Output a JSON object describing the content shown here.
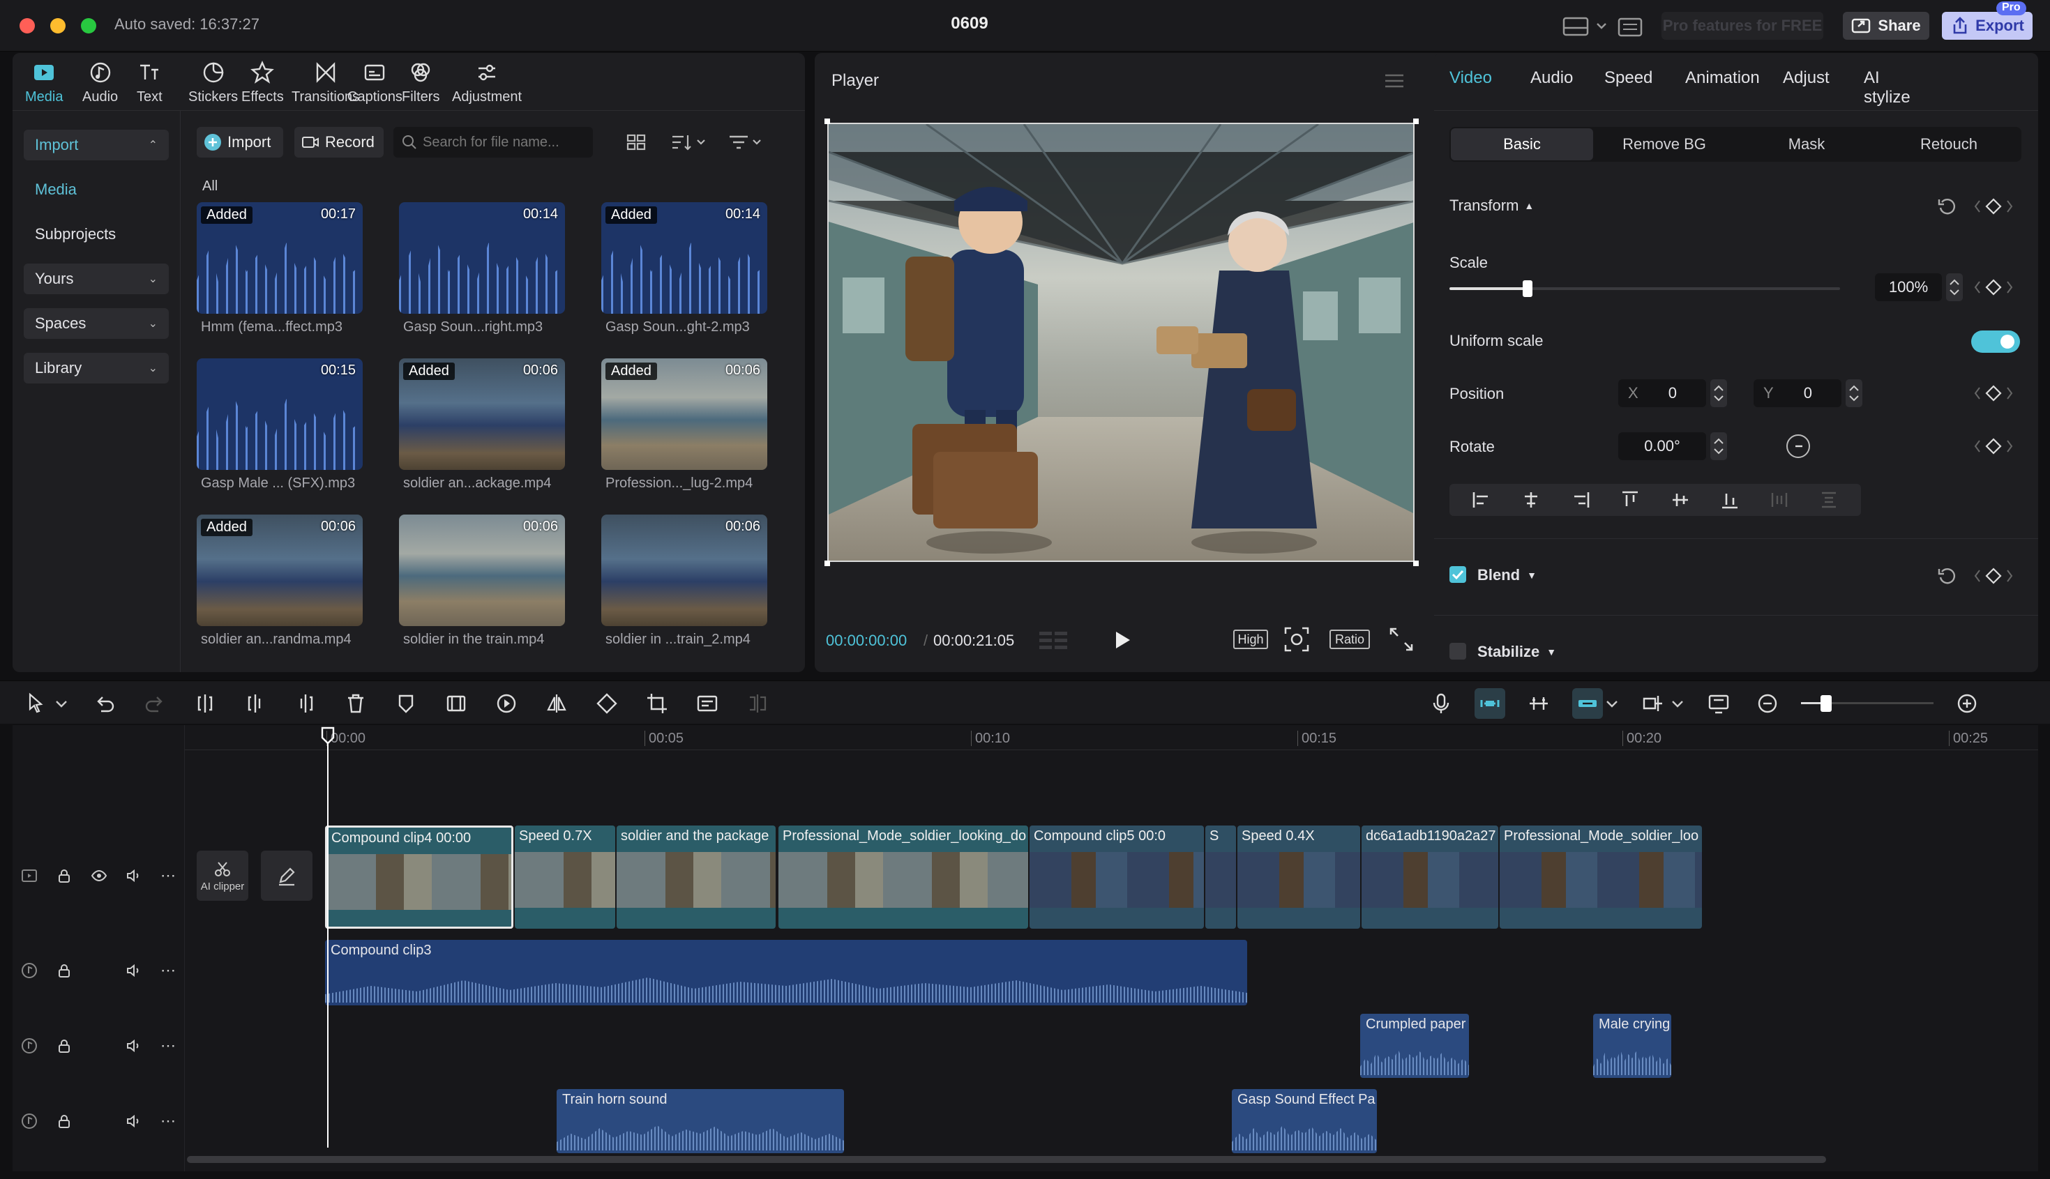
{
  "window": {
    "autosave": "Auto saved: 16:37:27",
    "title": "0609",
    "pro_text": "Pro features for FREE",
    "share": "Share",
    "export": "Export",
    "pro_badge": "Pro"
  },
  "media_tabs": [
    {
      "label": "Media",
      "icon": "media-icon"
    },
    {
      "label": "Audio",
      "icon": "audio-icon"
    },
    {
      "label": "Text",
      "icon": "text-icon"
    },
    {
      "label": "Stickers",
      "icon": "stickers-icon"
    },
    {
      "label": "Effects",
      "icon": "effects-icon"
    },
    {
      "label": "Transitions",
      "icon": "transitions-icon"
    },
    {
      "label": "Captions",
      "icon": "captions-icon"
    },
    {
      "label": "Filters",
      "icon": "filters-icon"
    },
    {
      "label": "Adjustment",
      "icon": "adjustment-icon"
    }
  ],
  "sidebar": {
    "import": "Import",
    "media": "Media",
    "subprojects": "Subprojects",
    "yours": "Yours",
    "spaces": "Spaces",
    "library": "Library"
  },
  "library": {
    "import_btn": "Import",
    "record_btn": "Record",
    "search_placeholder": "Search for file name...",
    "filter_label": "All",
    "items": [
      {
        "name": "Hmm (fema...ffect.mp3",
        "duration": "00:17",
        "badge": "Added",
        "kind": "audio"
      },
      {
        "name": "Gasp Soun...right.mp3",
        "duration": "00:14",
        "badge": "",
        "kind": "audio"
      },
      {
        "name": "Gasp Soun...ght-2.mp3",
        "duration": "00:14",
        "badge": "Added",
        "kind": "audio"
      },
      {
        "name": "Gasp Male ... (SFX).mp3",
        "duration": "00:15",
        "badge": "",
        "kind": "audio"
      },
      {
        "name": "soldier an...ackage.mp4",
        "duration": "00:06",
        "badge": "Added",
        "kind": "video"
      },
      {
        "name": "Profession..._lug-2.mp4",
        "duration": "00:06",
        "badge": "Added",
        "kind": "video"
      },
      {
        "name": "soldier an...randma.mp4",
        "duration": "00:06",
        "badge": "Added",
        "kind": "video"
      },
      {
        "name": "soldier in the train.mp4",
        "duration": "00:06",
        "badge": "",
        "kind": "video"
      },
      {
        "name": "soldier in ...train_2.mp4",
        "duration": "00:06",
        "badge": "",
        "kind": "video"
      }
    ]
  },
  "player": {
    "title": "Player",
    "current_time": "00:00:00:00",
    "total_time": "00:00:21:05",
    "quality": "High",
    "ratio": "Ratio"
  },
  "inspector": {
    "tabs": [
      "Video",
      "Audio",
      "Speed",
      "Animation",
      "Adjust",
      "AI stylize"
    ],
    "subtabs": [
      "Basic",
      "Remove BG",
      "Mask",
      "Retouch"
    ],
    "transform": "Transform",
    "scale_label": "Scale",
    "scale_value": "100%",
    "scale_fraction": 0.2,
    "uniform_scale": "Uniform scale",
    "position": "Position",
    "pos_x_label": "X",
    "pos_x": "0",
    "pos_y_label": "Y",
    "pos_y": "0",
    "rotate": "Rotate",
    "rotate_value": "0.00°",
    "blend": "Blend",
    "stabilize": "Stabilize"
  },
  "timeline": {
    "ruler": [
      "00:00",
      "00:05",
      "00:10",
      "00:15",
      "00:20",
      "00:25"
    ],
    "ai_clipper": "AI clipper",
    "video_clips": [
      {
        "label": "Compound clip4   00:00",
        "style": "light"
      },
      {
        "label": "Speed 0.7X",
        "style": "light"
      },
      {
        "label": "soldier and the package",
        "style": "light"
      },
      {
        "label": "Professional_Mode_soldier_looking_do",
        "style": "light"
      },
      {
        "label": "Compound clip5   00:0",
        "style": "dark"
      },
      {
        "label": "S",
        "style": "dark"
      },
      {
        "label": "Speed 0.4X",
        "style": "dark"
      },
      {
        "label": "dc6a1adb1190a2a27",
        "style": "dark"
      },
      {
        "label": "Professional_Mode_soldier_loo",
        "style": "dark"
      }
    ],
    "audio_clips": [
      {
        "label": "Compound clip3"
      },
      {
        "label": "Crumpled paper"
      },
      {
        "label": "Male crying"
      },
      {
        "label": "Train horn sound"
      },
      {
        "label": "Gasp Sound Effect Pa"
      }
    ]
  },
  "colors": {
    "accent": "#4fc3d9",
    "export": "#3d4fd8",
    "playhead": "#ffffff"
  }
}
